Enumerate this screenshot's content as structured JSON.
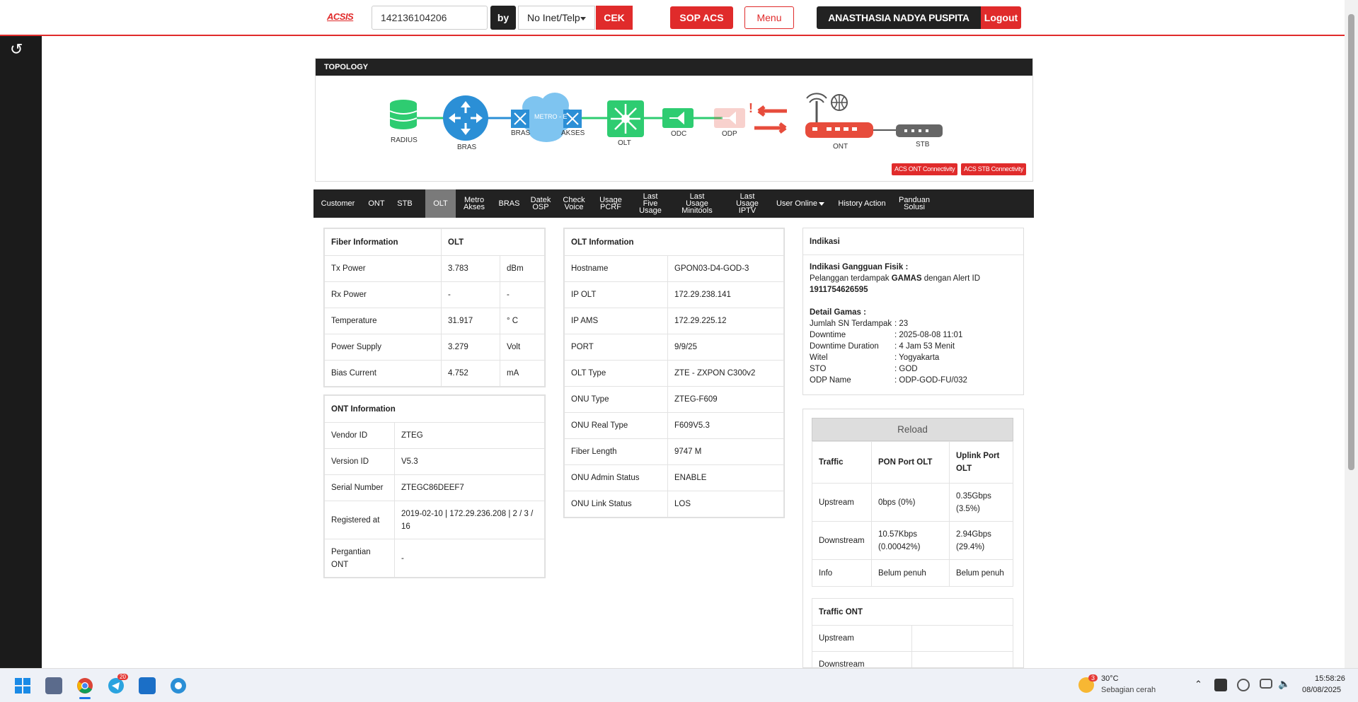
{
  "header": {
    "logo": "ACSIS",
    "search_value": "142136104206",
    "by_label": "by",
    "select_value": "No Inet/Telp",
    "cek_label": "CEK",
    "sop_label": "SOP ACS",
    "menu_label": "Menu",
    "user_name": "ANASTHASIA NADYA PUSPITA SARI",
    "logout_label": "Logout"
  },
  "topology": {
    "title": "TOPOLOGY",
    "nodes": {
      "radius": "RADIUS",
      "bras": "BRAS",
      "bras2": "BRAS",
      "metro": "METRO - E",
      "akses": "AKSES",
      "olt": "OLT",
      "odc": "ODC",
      "odp": "ODP",
      "ont": "ONT",
      "stb": "STB"
    },
    "buttons": {
      "ont_conn": "ACS ONT Connectivity",
      "stb_conn": "ACS STB Connectivity"
    },
    "colors": {
      "green": "#2ecc71",
      "blue": "#2b8fd6",
      "red": "#e74c3c",
      "gray": "#666666"
    }
  },
  "tabs": [
    {
      "label": "Customer"
    },
    {
      "label": "ONT"
    },
    {
      "label": "STB"
    },
    {
      "label": "OLT",
      "active": true
    },
    {
      "label": "Metro Akses"
    },
    {
      "label": "BRAS"
    },
    {
      "label": "Datek OSP"
    },
    {
      "label": "Check Voice"
    },
    {
      "label": "Usage PCRF"
    },
    {
      "label": "Last Five Usage"
    },
    {
      "label": "Last Usage Minitools"
    },
    {
      "label": "Last Usage IPTV"
    },
    {
      "label": "User Online"
    },
    {
      "label": "History Action"
    },
    {
      "label": "Panduan Solusi"
    }
  ],
  "fiber": {
    "header": [
      "Fiber Information",
      "OLT"
    ],
    "rows": [
      [
        "Tx Power",
        "3.783",
        "dBm"
      ],
      [
        "Rx Power",
        "-",
        "-"
      ],
      [
        "Temperature",
        "31.917",
        "° C"
      ],
      [
        "Power Supply",
        "3.279",
        "Volt"
      ],
      [
        "Bias Current",
        "4.752",
        "mA"
      ]
    ]
  },
  "ont": {
    "header": "ONT Information",
    "rows": [
      [
        "Vendor ID",
        "ZTEG"
      ],
      [
        "Version ID",
        "V5.3"
      ],
      [
        "Serial Number",
        "ZTEGC86DEEF7"
      ],
      [
        "Registered at",
        "2019-02-10 | 172.29.236.208 | 2 / 3 / 16"
      ],
      [
        "Pergantian ONT",
        "-"
      ]
    ]
  },
  "olt": {
    "header": "OLT Information",
    "rows": [
      [
        "Hostname",
        "GPON03-D4-GOD-3"
      ],
      [
        "IP OLT",
        "172.29.238.141"
      ],
      [
        "IP AMS",
        "172.29.225.12"
      ],
      [
        "PORT",
        "9/9/25"
      ],
      [
        "OLT Type",
        "ZTE - ZXPON C300v2"
      ],
      [
        "ONU Type",
        "ZTEG-F609"
      ],
      [
        "ONU Real Type",
        "F609V5.3"
      ],
      [
        "Fiber Length",
        "9747 M"
      ],
      [
        "ONU Admin Status",
        "ENABLE"
      ],
      [
        "ONU Link Status",
        "LOS"
      ]
    ]
  },
  "indikasi": {
    "title": "Indikasi",
    "gangguan_title": "Indikasi Gangguan Fisik :",
    "line1_pre": "Pelanggan terdampak ",
    "line1_bold": "GAMAS",
    "line1_post": " dengan Alert ID",
    "alert_id": "1911754626595",
    "detail_title": "Detail Gamas :",
    "details": [
      [
        "Jumlah SN Terdampak",
        ": 23"
      ],
      [
        "Downtime",
        ": 2025-08-08 11:01"
      ],
      [
        "Downtime Duration",
        ": 4 Jam 53 Menit"
      ],
      [
        "Witel",
        ": Yogyakarta"
      ],
      [
        "STO",
        ": GOD"
      ],
      [
        "ODP Name",
        ": ODP-GOD-FU/032"
      ]
    ]
  },
  "traffic": {
    "reload_label": "Reload",
    "header": [
      "Traffic",
      "PON Port OLT",
      "Uplink Port OLT"
    ],
    "rows": [
      [
        "Upstream",
        "0bps (0%)",
        "0.35Gbps (3.5%)"
      ],
      [
        "Downstream",
        "10.57Kbps (0.00042%)",
        "2.94Gbps (29.4%)"
      ],
      [
        "Info",
        "Belum penuh",
        "Belum penuh"
      ]
    ],
    "ont_header": "Traffic ONT",
    "ont_rows": [
      [
        "Upstream",
        ""
      ],
      [
        "Downstream",
        ""
      ]
    ]
  },
  "taskbar": {
    "weather_temp": "30°C",
    "weather_desc": "Sebagian cerah",
    "weather_badge": "3",
    "time": "15:58:26",
    "date": "08/08/2025",
    "telegram_badge": "20"
  }
}
